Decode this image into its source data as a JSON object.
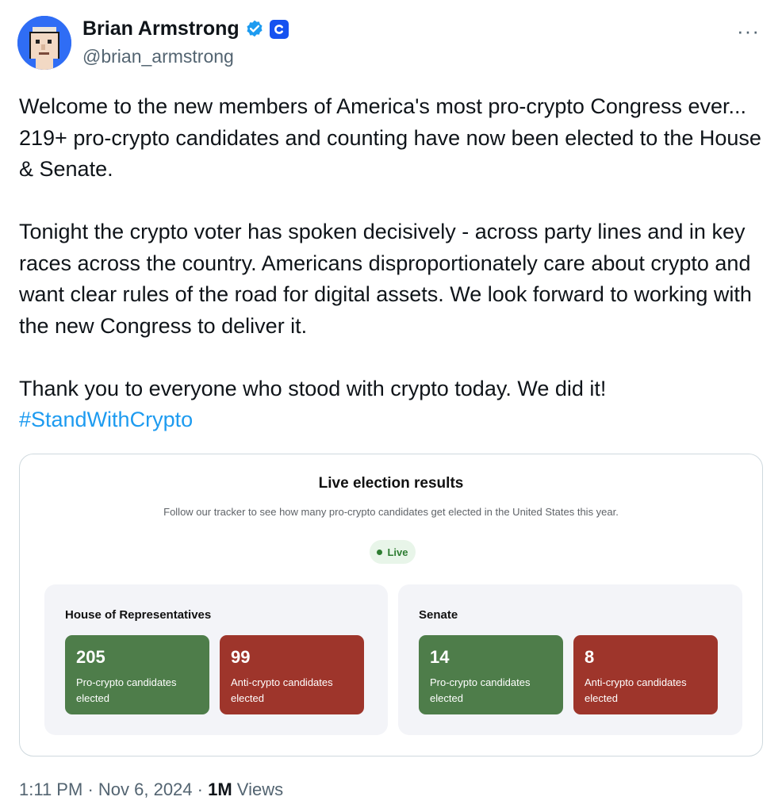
{
  "author": {
    "name": "Brian Armstrong",
    "handle": "@brian_armstrong",
    "verified_icon": "verified-badge-icon",
    "affiliation_icon": "coinbase-logo-icon",
    "more_label": "···"
  },
  "body": {
    "paragraph1": "Welcome to the new members of America's most pro-crypto Congress ever... 219+ pro-crypto candidates and counting have now been elected to the House & Senate.",
    "paragraph2": "Tonight the crypto voter has spoken decisively - across party lines and in key races across the country. Americans disproportionately care about crypto and want clear rules of the road for digital assets. We look forward to working with the new Congress to deliver it.",
    "paragraph3": "Thank you to everyone who stood with crypto today. We did it!",
    "hashtag": "#StandWithCrypto"
  },
  "card": {
    "title": "Live election results",
    "subtitle": "Follow our tracker to see how many pro-crypto candidates get elected in the United States this year.",
    "live_label": "Live",
    "house": {
      "title": "House of Representatives",
      "pro_value": "205",
      "pro_label": "Pro-crypto candidates elected",
      "anti_value": "99",
      "anti_label": "Anti-crypto candidates elected"
    },
    "senate": {
      "title": "Senate",
      "pro_value": "14",
      "pro_label": "Pro-crypto candidates elected",
      "anti_value": "8",
      "anti_label": "Anti-crypto candidates elected"
    },
    "colors": {
      "pro": "#4e7d4a",
      "anti": "#9e352b",
      "live": "#2e7d32"
    }
  },
  "footer": {
    "time": "1:11 PM",
    "sep": "·",
    "date": "Nov 6, 2024",
    "views_count": "1M",
    "views_label": "Views"
  },
  "colors": {
    "link": "#1d9bf0",
    "verified": "#1d9bf0",
    "muted": "#536471"
  }
}
